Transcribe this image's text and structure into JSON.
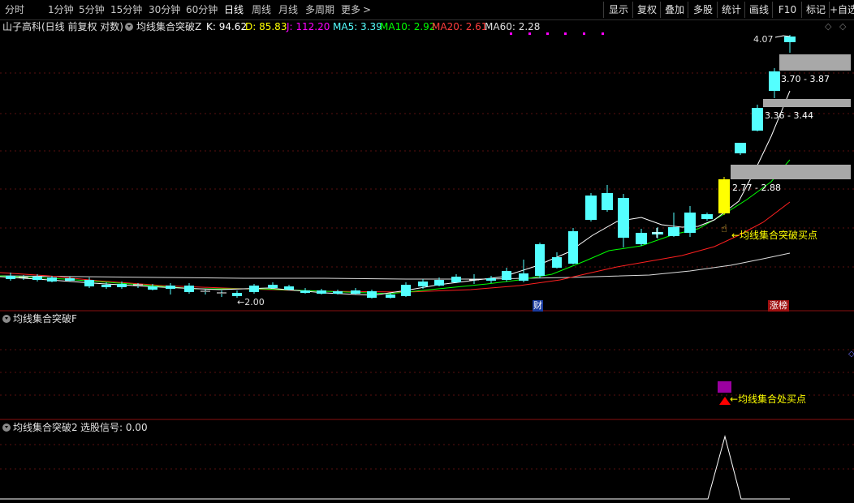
{
  "toolbar": {
    "timeframes": [
      "分时",
      "1分钟",
      "5分钟",
      "15分钟",
      "30分钟",
      "60分钟",
      "日线",
      "周线",
      "月线",
      "多周期",
      "更多"
    ],
    "active_timeframe": "日线",
    "more_arrow": ">",
    "right_buttons": [
      "显示",
      "复权",
      "叠加",
      "多股",
      "统计",
      "画线",
      "F10",
      "标记",
      "+自选"
    ]
  },
  "chart_header": {
    "stock": "山子高科(日线 前复权 对数)",
    "indicator": "均线集合突破Z",
    "K": "K: 94.62",
    "D": "D: 85.83",
    "J": "J: 112.20",
    "MA5": "MA5: 3.39",
    "MA10": "MA10: 2.92",
    "MA20": "MA20: 2.61",
    "MA60": "MA60: 2.28"
  },
  "main_chart": {
    "high_label": "4.07",
    "low_label": "←2.00",
    "zones": [
      {
        "label": "3.70 - 3.87"
      },
      {
        "label": "3.36 - 3.44"
      },
      {
        "label": "2.77 - 2.88"
      }
    ],
    "signal_label": "←均线集合突破买点",
    "tag_cai": "财",
    "tag_zhangbang": "涨榜",
    "colors": {
      "up": "#ff3c3c",
      "down": "#54ffff",
      "ma5": "#ffffff",
      "ma10": "#00ff00",
      "ma20": "#ff2020",
      "ma60": "#dcdcdc",
      "zone": "#a8a8a8",
      "signal": "#ffff00"
    }
  },
  "panel2": {
    "title": "均线集合突破F",
    "signal_label": "←均线集合处买点"
  },
  "panel3": {
    "title": "均线集合突破2",
    "value": "选股信号: 0.00"
  }
}
